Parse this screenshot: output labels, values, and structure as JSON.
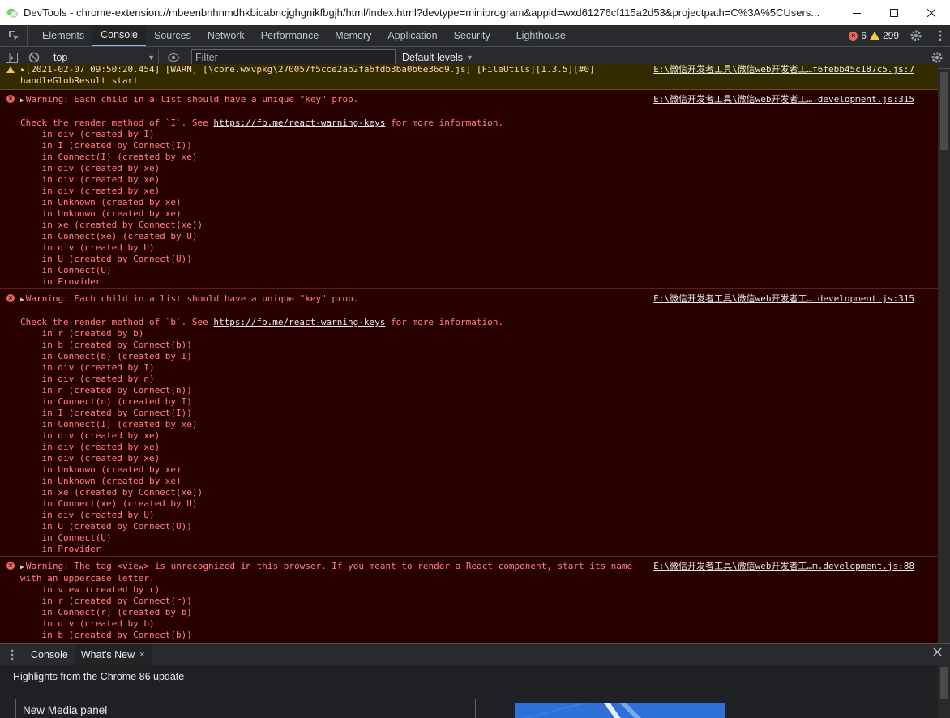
{
  "window": {
    "title": "DevTools - chrome-extension://mbeenbnhnmdhkbicabncjghgnikfbgjh/html/index.html?devtype=miniprogram&appid=wxd61276cf115a2d53&projectpath=C%3A%5CUsers...",
    "minimize_icon": "minimize-icon",
    "maximize_icon": "maximize-icon",
    "close_icon": "close-icon"
  },
  "tabs": [
    "Elements",
    "Console",
    "Sources",
    "Network",
    "Performance",
    "Memory",
    "Application",
    "Security",
    "Lighthouse"
  ],
  "active_tab": "Console",
  "status": {
    "errors": "6",
    "warnings": "299"
  },
  "toolbar": {
    "context": "top",
    "filter_placeholder": "Filter",
    "levels": "Default levels"
  },
  "messages": {
    "warn": {
      "line1": "▸[2021-02-07 09:50:20.454] [WARN] [\\core.wxvpkg\\270057f5cce2ab2fa6fdb3ba0b6e36d9.js] [FileUtils][1.3.5][#0]",
      "line2": "handleGlobResult start",
      "source": "E:\\微信开发者工具\\微信web开发者工…f6febb45c187c5.js:7"
    },
    "err1": {
      "headline": "Warning: Each child in a list should have a unique \"key\" prop.",
      "source": "E:\\微信开发者工具\\微信web开发者工….development.js:315",
      "check_prefix": "Check the render method of `I`. See ",
      "link": "https://fb.me/react-warning-keys",
      "check_suffix": " for more information.",
      "stack": "    in div (created by I)\n    in I (created by Connect(I))\n    in Connect(I) (created by xe)\n    in div (created by xe)\n    in div (created by xe)\n    in div (created by xe)\n    in Unknown (created by xe)\n    in Unknown (created by xe)\n    in xe (created by Connect(xe))\n    in Connect(xe) (created by U)\n    in div (created by U)\n    in U (created by Connect(U))\n    in Connect(U)\n    in Provider"
    },
    "err2": {
      "headline": "Warning: Each child in a list should have a unique \"key\" prop.",
      "source": "E:\\微信开发者工具\\微信web开发者工….development.js:315",
      "check_prefix": "Check the render method of `b`. See ",
      "link": "https://fb.me/react-warning-keys",
      "check_suffix": " for more information.",
      "stack": "    in r (created by b)\n    in b (created by Connect(b))\n    in Connect(b) (created by I)\n    in div (created by I)\n    in div (created by n)\n    in n (created by Connect(n))\n    in Connect(n) (created by I)\n    in I (created by Connect(I))\n    in Connect(I) (created by xe)\n    in div (created by xe)\n    in div (created by xe)\n    in div (created by xe)\n    in Unknown (created by xe)\n    in Unknown (created by xe)\n    in xe (created by Connect(xe))\n    in Connect(xe) (created by U)\n    in div (created by U)\n    in U (created by Connect(U))\n    in Connect(U)\n    in Provider"
    },
    "err3": {
      "headline": "Warning: The tag <view> is unrecognized in this browser. If you meant to render a React component, start its name",
      "line2": "with an uppercase letter.",
      "source": "E:\\微信开发者工具\\微信web开发者工…m.development.js:88",
      "stack": "    in view (created by r)\n    in r (created by Connect(r))\n    in Connect(r) (created by b)\n    in div (created by b)\n    in b (created by Connect(b))\n    in Connect(b) (created by I)"
    }
  },
  "drawer": {
    "tabs": [
      "Console",
      "What's New"
    ],
    "active": "What's New",
    "close_glyph": "×",
    "highlights": "Highlights from the Chrome 86 update",
    "item": "New Media panel"
  },
  "colors": {
    "error_bg": "#290000",
    "error_text": "#ff8080",
    "warn_bg": "#332b00",
    "accent": "#8ab4f8"
  }
}
